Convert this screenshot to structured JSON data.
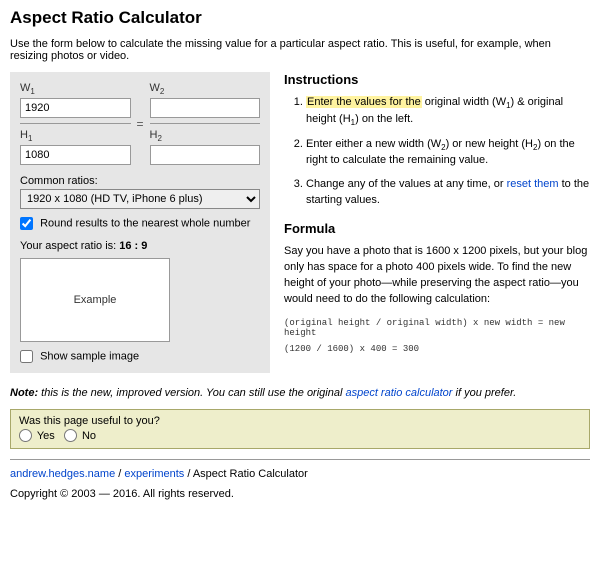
{
  "title": "Aspect Ratio Calculator",
  "intro": "Use the form below to calculate the missing value for a particular aspect ratio. This is useful, for example, when resizing photos or video.",
  "form": {
    "w1_label": "W",
    "w1_sub": "1",
    "w1_value": "1920",
    "w2_label": "W",
    "w2_sub": "2",
    "w2_value": "",
    "h1_label": "H",
    "h1_sub": "1",
    "h1_value": "1080",
    "h2_label": "H",
    "h2_sub": "2",
    "h2_value": "",
    "equals": "=",
    "common_label": "Common ratios:",
    "common_selected": "1920 x 1080 (HD TV, iPhone 6 plus)",
    "round_label": "Round results to the nearest whole number",
    "ratio_prefix": "Your aspect ratio is: ",
    "ratio_value": "16 : 9",
    "example_label": "Example",
    "show_sample_label": "Show sample image"
  },
  "instructions": {
    "heading": "Instructions",
    "step1_a": "Enter the values for the",
    "step1_b": " original width (W",
    "step1_c": ") & original height (H",
    "step1_d": ") on the left.",
    "step2_a": "Enter either a new width (W",
    "step2_b": ") or new height (H",
    "step2_c": ") on the right to calculate the remaining value.",
    "step3_a": "Change any of the values at any time, or ",
    "step3_link": "reset them",
    "step3_b": " to the starting values.",
    "sub1": "1",
    "sub2": "2"
  },
  "formula": {
    "heading": "Formula",
    "para": "Say you have a photo that is 1600 x 1200 pixels, but your blog only has space for a photo 400 pixels wide. To find the new height of your photo—while preserving the aspect ratio—you would need to do the following calculation:",
    "line1": "(original height / original width) x new width = new height",
    "line2": "(1200 / 1600) x 400 = 300"
  },
  "note": {
    "label": "Note:",
    "text_a": " this is the new, improved version. You can still use the original ",
    "link": "aspect ratio calculator",
    "text_b": " if you prefer."
  },
  "feedback": {
    "question": "Was this page useful to you?",
    "yes": "Yes",
    "no": "No"
  },
  "breadcrumb": {
    "link1": "andrew.hedges.name",
    "sep": " / ",
    "link2": "experiments",
    "current": "Aspect Ratio Calculator"
  },
  "copyright": "Copyright © 2003 — 2016. All rights reserved."
}
